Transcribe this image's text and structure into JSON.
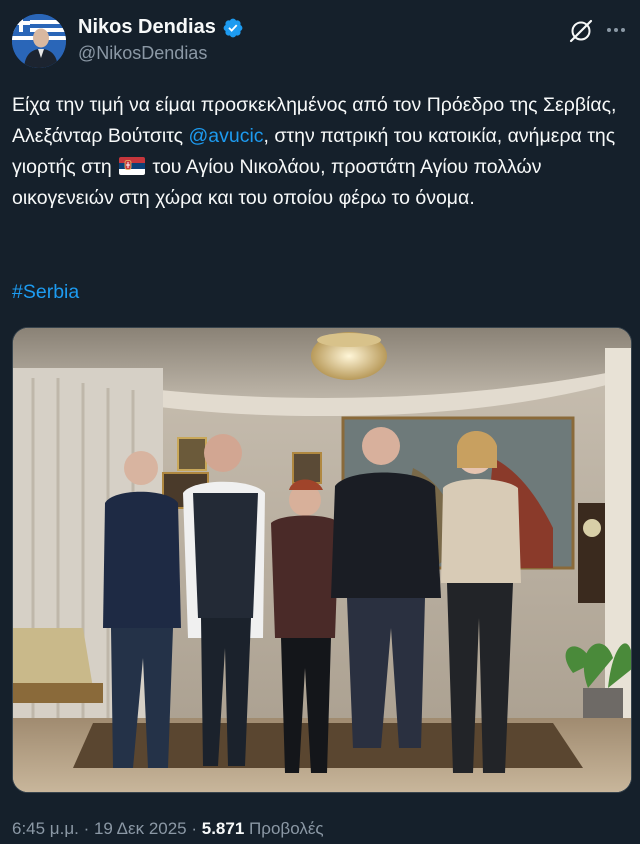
{
  "author": {
    "display_name": "Nikos Dendias",
    "handle": "@NikosDendias",
    "verified": true,
    "avatar_icon": "profile-photo-with-greek-flag"
  },
  "actions": {
    "grok_icon": "grok-icon",
    "more_icon": "more-options-icon"
  },
  "tweet": {
    "segments": {
      "s1": "Είχα την τιμή να είμαι προσκεκλημένος από τον Πρόεδρο της Σερβίας, Αλεξάνταρ Βούτσιτς ",
      "mention": "@avucic",
      "s2": ", στην πατρική του κατοικία, ανήμερα της γιορτής στη ",
      "flag": "serbia-flag-emoji",
      "s3": " του Αγίου Νικολάου, προστάτη Αγίου πολλών οικογενειών στη χώρα και του οποίου φέρω το όνομα."
    },
    "hashtag": "#Serbia"
  },
  "media": {
    "type": "photo",
    "subject": "group-photo-five-people-living-room"
  },
  "meta": {
    "time": "6:45 μ.μ.",
    "separator1": " · ",
    "date": "19 Δεκ 2025",
    "separator2": " · ",
    "views": "5.871",
    "views_label": " Προβολές"
  },
  "colors": {
    "background": "#15202b",
    "text": "#f7f9f9",
    "secondary": "#8b98a5",
    "accent": "#1d9bf0"
  }
}
